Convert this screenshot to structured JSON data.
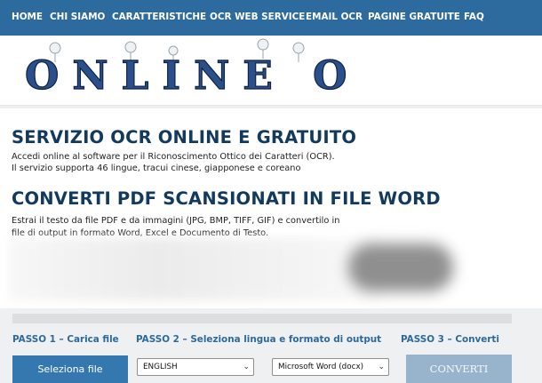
{
  "nav": {
    "items": [
      "HOME",
      "CHI SIAMO",
      "CARATTERISTICHE",
      "OCR WEB SERVICE",
      "EMAIL OCR",
      "PAGINE GRATUITE",
      "FAQ"
    ]
  },
  "logo": {
    "text": "ONLINE OCR"
  },
  "section1": {
    "title": "SERVIZIO OCR ONLINE E GRATUITO",
    "line1": "Accedi online al software per il Riconoscimento Ottico dei Caratteri (OCR).",
    "line2": "Il servizio supporta 46 lingue, tracui cinese, giapponese e coreano"
  },
  "section2": {
    "title": "CONVERTI PDF SCANSIONATI IN FILE WORD",
    "line1": "Estrai il testo da file PDF e da immagini (JPG, BMP, TIFF, GIF) e convertilo in",
    "line2": "file di output in formato Word, Excel e Documento di Testo."
  },
  "steps": {
    "step1": "PASSO 1 – Carica file",
    "step2": "PASSO 2 – Seleziona lingua e formato di output",
    "step3": "PASSO 3 – Converti"
  },
  "controls": {
    "select_file": "Seleziona file",
    "language": "ENGLISH",
    "format": "Microsoft Word (docx)",
    "convert": "CONVERTI"
  },
  "colors": {
    "nav_bg": "#2d6b9e",
    "title": "#123a5e",
    "step_label": "#2b6a9e",
    "primary_button": "#3578b0",
    "convert_button": "#98b3cc"
  }
}
